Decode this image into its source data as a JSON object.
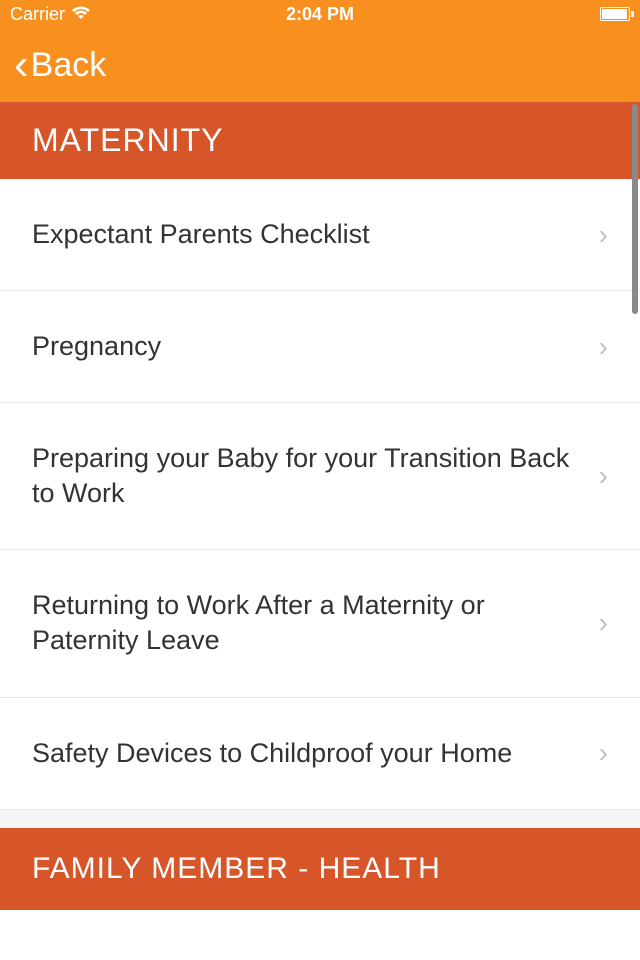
{
  "status_bar": {
    "carrier": "Carrier",
    "time": "2:04 PM"
  },
  "nav": {
    "back_label": "Back"
  },
  "sections": [
    {
      "title": "MATERNITY",
      "items": [
        "Expectant Parents Checklist",
        "Pregnancy",
        "Preparing your Baby for your Transition Back to Work",
        "Returning to Work After a Maternity or Paternity Leave",
        "Safety Devices to Childproof your Home"
      ]
    },
    {
      "title": "FAMILY MEMBER - HEALTH",
      "items": []
    }
  ]
}
